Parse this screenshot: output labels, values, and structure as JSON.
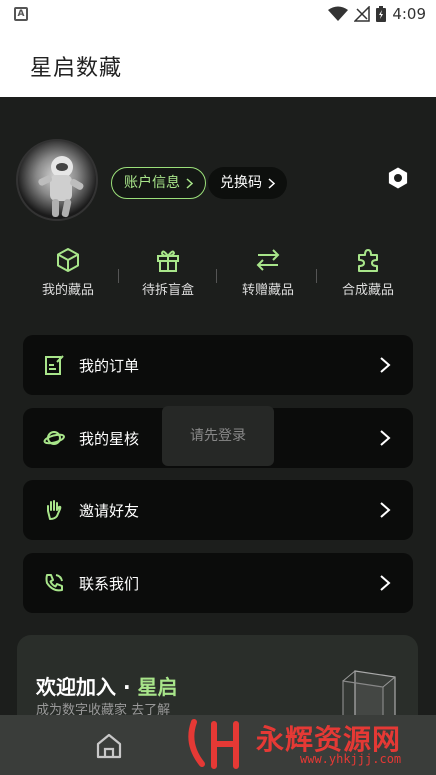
{
  "status_bar": {
    "time": "4:09"
  },
  "app_bar": {
    "title": "星启数藏"
  },
  "profile": {
    "account_button": "账户信息",
    "redeem_button": "兑换码"
  },
  "quick_actions": [
    {
      "label": "我的藏品",
      "icon": "cube-icon"
    },
    {
      "label": "待拆盲盒",
      "icon": "gift-icon"
    },
    {
      "label": "转赠藏品",
      "icon": "transfer-icon"
    },
    {
      "label": "合成藏品",
      "icon": "puzzle-icon"
    }
  ],
  "menu": [
    {
      "label": "我的订单",
      "icon": "order-icon"
    },
    {
      "label": "我的星核",
      "icon": "planet-icon"
    },
    {
      "label": "邀请好友",
      "icon": "hand-icon"
    },
    {
      "label": "联系我们",
      "icon": "phone-icon"
    }
  ],
  "toast": {
    "text": "请先登录"
  },
  "welcome": {
    "title_prefix": "欢迎加入 · ",
    "title_accent": "星启",
    "subtitle": "成为数字收藏家 去了解"
  },
  "watermark": {
    "text": "永辉资源网",
    "url": "www.yhkjjj.com"
  },
  "colors": {
    "accent": "#a8e58a",
    "background": "#1c1e1c",
    "card": "#0b0c0b"
  }
}
